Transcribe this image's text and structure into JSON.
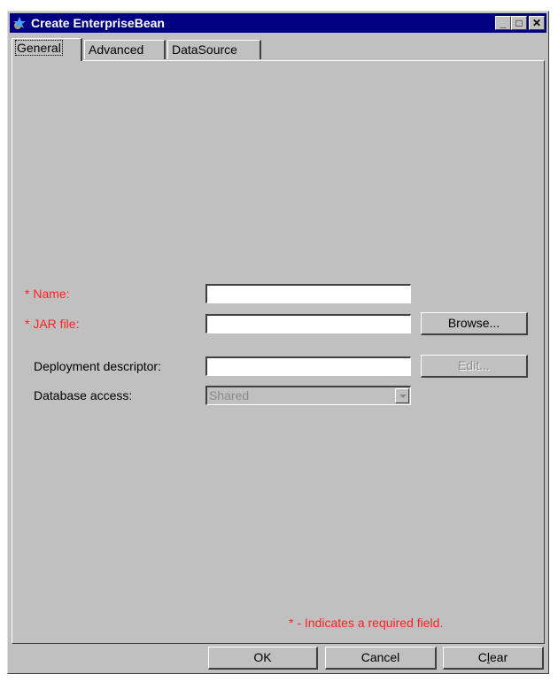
{
  "window": {
    "title": "Create EnterpriseBean",
    "controls": {
      "minimize": "_",
      "maximize": "□",
      "close": "✕"
    }
  },
  "tabs": [
    {
      "label": "General",
      "active": true
    },
    {
      "label": "Advanced",
      "active": false
    },
    {
      "label": "DataSource",
      "active": false
    }
  ],
  "form": {
    "name_label": "* Name:",
    "name_value": "",
    "jar_label": "* JAR file:",
    "jar_value": "",
    "browse_label": "Browse...",
    "descriptor_label": "Deployment descriptor:",
    "descriptor_value": "",
    "edit_label": "Edit...",
    "db_access_label": "Database access:",
    "db_access_value": "Shared"
  },
  "note": "* - Indicates a required field.",
  "buttons": {
    "ok": "OK",
    "cancel": "Cancel",
    "clear_prefix": "C",
    "clear_mnemonic": "l",
    "clear_suffix": "ear"
  },
  "colors": {
    "title_bar": "#000080",
    "required": "#ff2020",
    "face": "#c0c0c0"
  },
  "icons": {
    "app": "bean-app-icon",
    "dropdown": "chevron-down-icon"
  }
}
